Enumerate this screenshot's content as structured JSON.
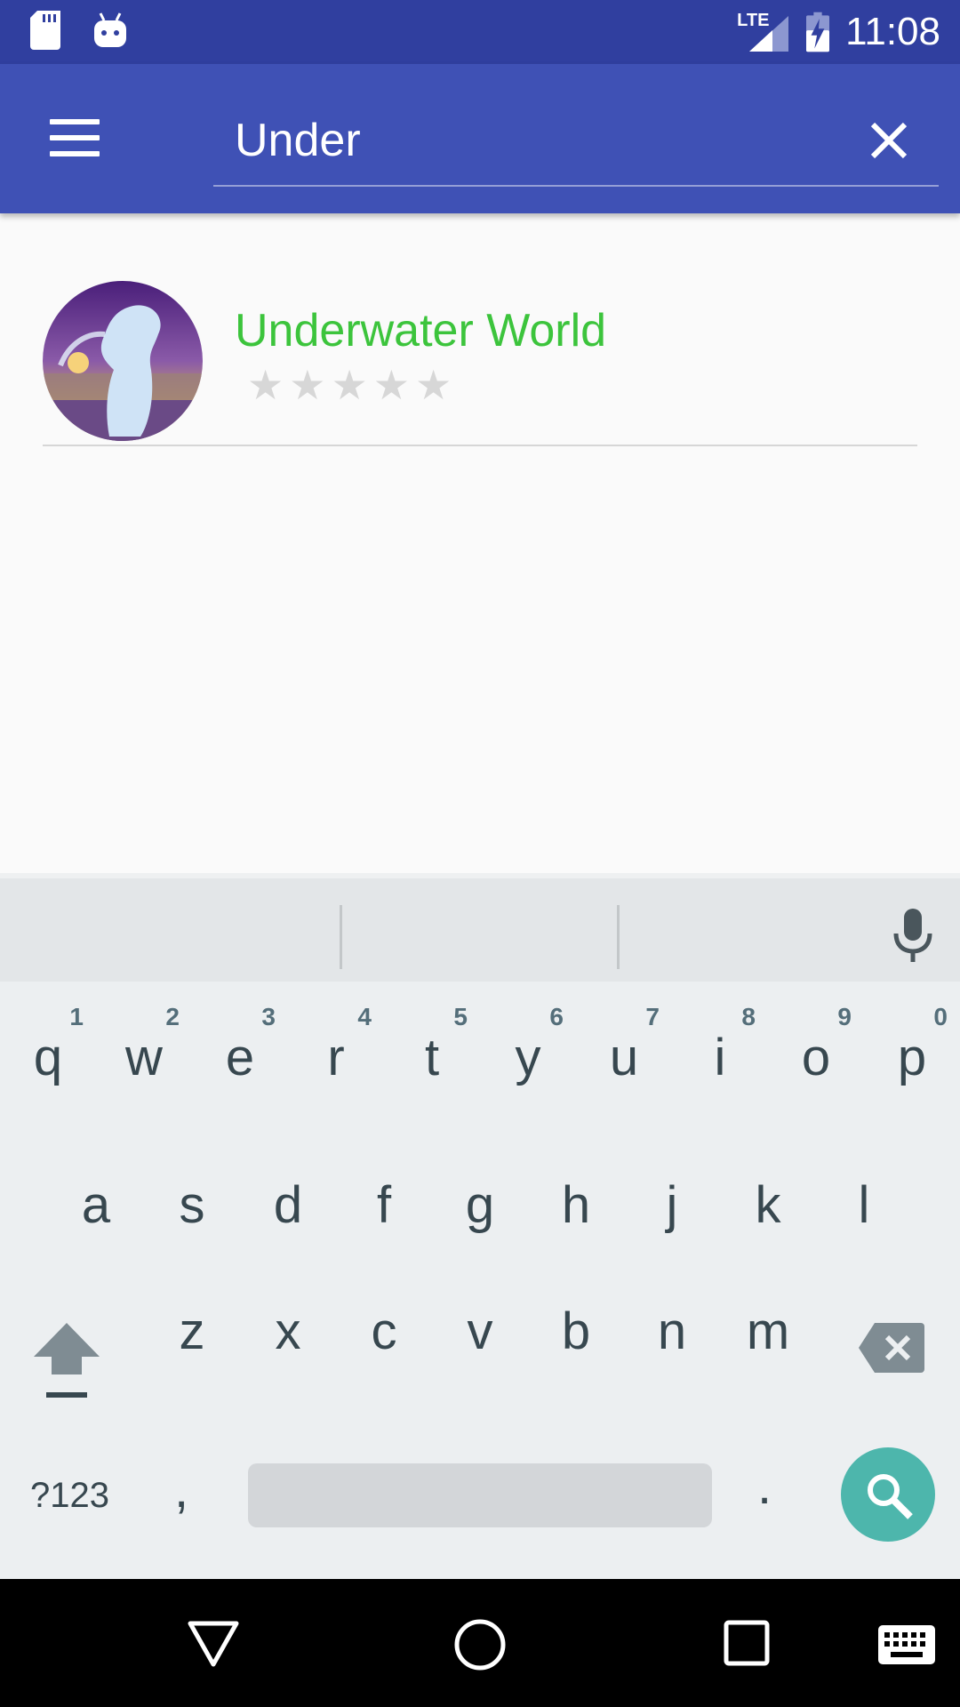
{
  "status_bar": {
    "time": "11:08",
    "network": "LTE",
    "icons": [
      "sd-card-icon",
      "android-debug-icon",
      "signal-icon",
      "battery-charging-icon"
    ]
  },
  "app_bar": {
    "search_value": "Under",
    "icons": [
      "menu-icon",
      "close-icon"
    ]
  },
  "results": [
    {
      "title": "Underwater World",
      "rating": 0,
      "max_rating": 5,
      "avatar_icon": "merlion-image"
    }
  ],
  "keyboard": {
    "row1": [
      {
        "key": "q",
        "hint": "1"
      },
      {
        "key": "w",
        "hint": "2"
      },
      {
        "key": "e",
        "hint": "3"
      },
      {
        "key": "r",
        "hint": "4"
      },
      {
        "key": "t",
        "hint": "5"
      },
      {
        "key": "y",
        "hint": "6"
      },
      {
        "key": "u",
        "hint": "7"
      },
      {
        "key": "i",
        "hint": "8"
      },
      {
        "key": "o",
        "hint": "9"
      },
      {
        "key": "p",
        "hint": "0"
      }
    ],
    "row2": [
      "a",
      "s",
      "d",
      "f",
      "g",
      "h",
      "j",
      "k",
      "l"
    ],
    "row3": [
      "z",
      "x",
      "c",
      "v",
      "b",
      "n",
      "m"
    ],
    "symbols_label": "?123",
    "comma": ",",
    "period": ".",
    "icons": [
      "mic-icon",
      "shift-icon",
      "backspace-icon",
      "search-icon"
    ]
  },
  "nav_bar": {
    "icons": [
      "back-icon",
      "home-icon",
      "recents-icon",
      "keyboard-switch-icon"
    ]
  },
  "colors": {
    "status_bar": "#303f9f",
    "app_bar": "#3f51b5",
    "result_title": "#3cc43c",
    "search_key": "#4db6ac"
  }
}
